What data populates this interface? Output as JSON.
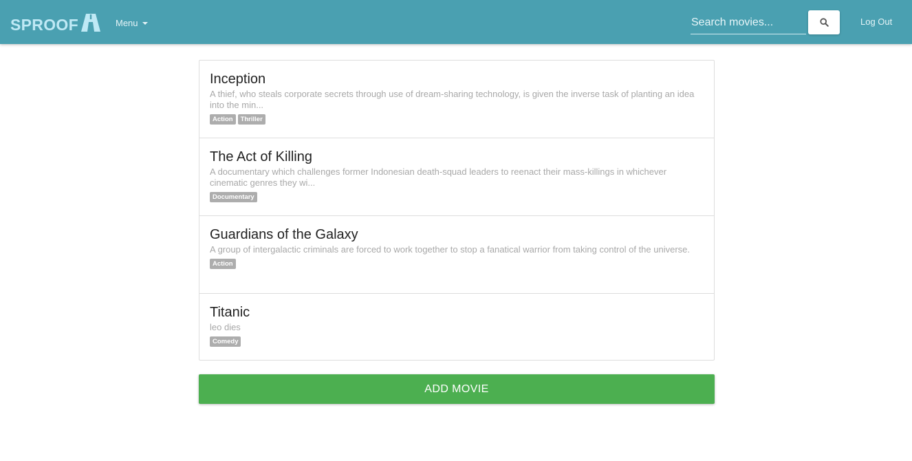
{
  "brand": {
    "name": "SPROOF",
    "logo_icon": "road-a-logo-icon"
  },
  "nav": {
    "menu_label": "Menu",
    "search_placeholder": "Search movies...",
    "search_value": "",
    "search_icon": "search-icon",
    "logout_label": "Log Out"
  },
  "movies": [
    {
      "title": "Inception",
      "description": "A thief, who steals corporate secrets through use of dream-sharing technology, is given the inverse task of planting an idea into the min...",
      "tags": [
        "Action",
        "Thriller"
      ]
    },
    {
      "title": "The Act of Killing",
      "description": "A documentary which challenges former Indonesian death-squad leaders to reenact their mass-killings in whichever cinematic genres they wi...",
      "tags": [
        "Documentary"
      ]
    },
    {
      "title": "Guardians of the Galaxy",
      "description": "A group of intergalactic criminals are forced to work together to stop a fanatical warrior from taking control of the universe.",
      "tags": [
        "Action"
      ]
    },
    {
      "title": "Titanic",
      "description": "leo dies",
      "tags": [
        "Comedy"
      ]
    }
  ],
  "add_button_label": "ADD MOVIE",
  "colors": {
    "navbar": "#4aa0b1",
    "brand": "#bfe9f5",
    "add_button": "#4caf50",
    "tag": "#adadad"
  }
}
